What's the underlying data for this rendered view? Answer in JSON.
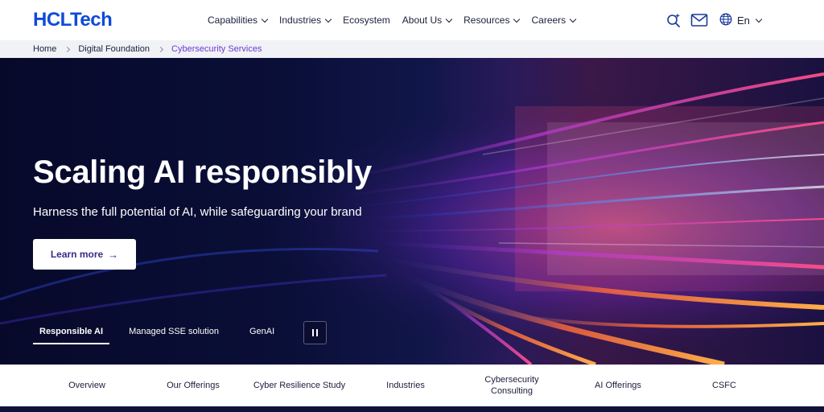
{
  "header": {
    "logo": "HCLTech",
    "nav": [
      {
        "label": "Capabilities",
        "has_dropdown": true
      },
      {
        "label": "Industries",
        "has_dropdown": true
      },
      {
        "label": "Ecosystem",
        "has_dropdown": false
      },
      {
        "label": "About Us",
        "has_dropdown": true
      },
      {
        "label": "Resources",
        "has_dropdown": true
      },
      {
        "label": "Careers",
        "has_dropdown": true
      }
    ],
    "icons": [
      "ai-search-icon",
      "mail-icon",
      "globe-icon"
    ],
    "language": "En"
  },
  "breadcrumb": {
    "items": [
      "Home",
      "Digital Foundation",
      "Cybersecurity Services"
    ]
  },
  "hero": {
    "title": "Scaling AI responsibly",
    "subtitle": "Harness the full potential of AI, while safeguarding your brand",
    "cta_label": "Learn more",
    "cta_icon": "arrow-right-icon",
    "tabs": [
      {
        "label": "Responsible AI",
        "active": true
      },
      {
        "label": "Managed SSE solution",
        "active": false
      },
      {
        "label": "GenAI",
        "active": false
      }
    ],
    "pause_icon": "pause-icon"
  },
  "subnav": {
    "items": [
      "Overview",
      "Our Offerings",
      "Cyber Resilience Study",
      "Industries",
      "Cybersecurity Consulting",
      "AI Offerings",
      "CSFC"
    ]
  },
  "colors": {
    "brand": "#0f4ad8",
    "breadcrumb_current": "#6d3ad6",
    "hero_bg": "#07092a"
  }
}
